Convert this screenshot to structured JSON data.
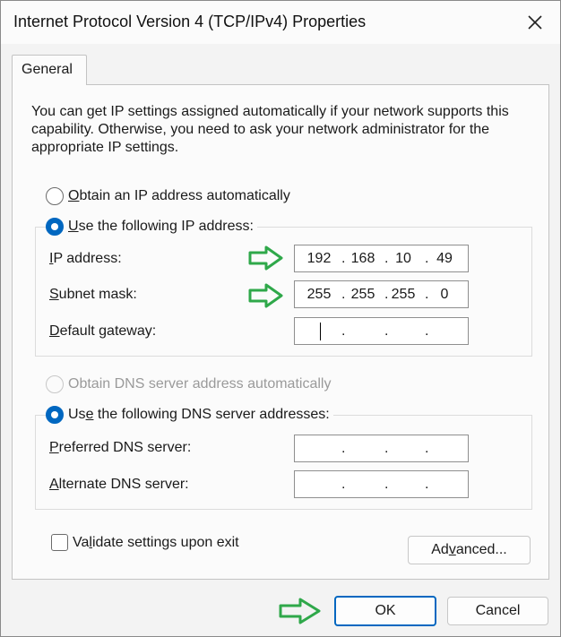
{
  "window": {
    "title": "Internet Protocol Version 4 (TCP/IPv4) Properties",
    "close_icon": "close-icon"
  },
  "tabs": [
    {
      "label": "General",
      "selected": true
    }
  ],
  "description": "You can get IP settings assigned automatically if your network supports this capability. Otherwise, you need to ask your network administrator for the appropriate IP settings.",
  "ip": {
    "auto": {
      "label": "Obtain an IP address automatically",
      "selected": false
    },
    "manual": {
      "label": "Use the following IP address:",
      "selected": true
    },
    "address": {
      "label": "IP address:",
      "octets": [
        "192",
        "168",
        "10",
        "49"
      ]
    },
    "subnet": {
      "label": "Subnet mask:",
      "octets": [
        "255",
        "255",
        "255",
        "0"
      ]
    },
    "gateway": {
      "label": "Default gateway:",
      "octets": [
        "",
        "",
        "",
        ""
      ]
    }
  },
  "dns": {
    "auto": {
      "label": "Obtain DNS server address automatically",
      "selected": false,
      "disabled": true
    },
    "manual": {
      "label": "Use the following DNS server addresses:",
      "selected": true
    },
    "preferred": {
      "label": "Preferred DNS server:",
      "octets": [
        "",
        "",
        "",
        ""
      ]
    },
    "alternate": {
      "label": "Alternate DNS server:",
      "octets": [
        "",
        "",
        "",
        ""
      ]
    }
  },
  "validate": {
    "label": "Validate settings upon exit",
    "checked": false
  },
  "buttons": {
    "advanced": "Advanced...",
    "ok": "OK",
    "cancel": "Cancel"
  },
  "colors": {
    "accent": "#0067c0",
    "arrow": "#2fa84a",
    "panel": "#fbfbfb",
    "window": "#f3f3f3"
  },
  "annotations": {
    "arrow_icon": "right-arrow-icon",
    "arrow_color": "#2fa84a"
  }
}
